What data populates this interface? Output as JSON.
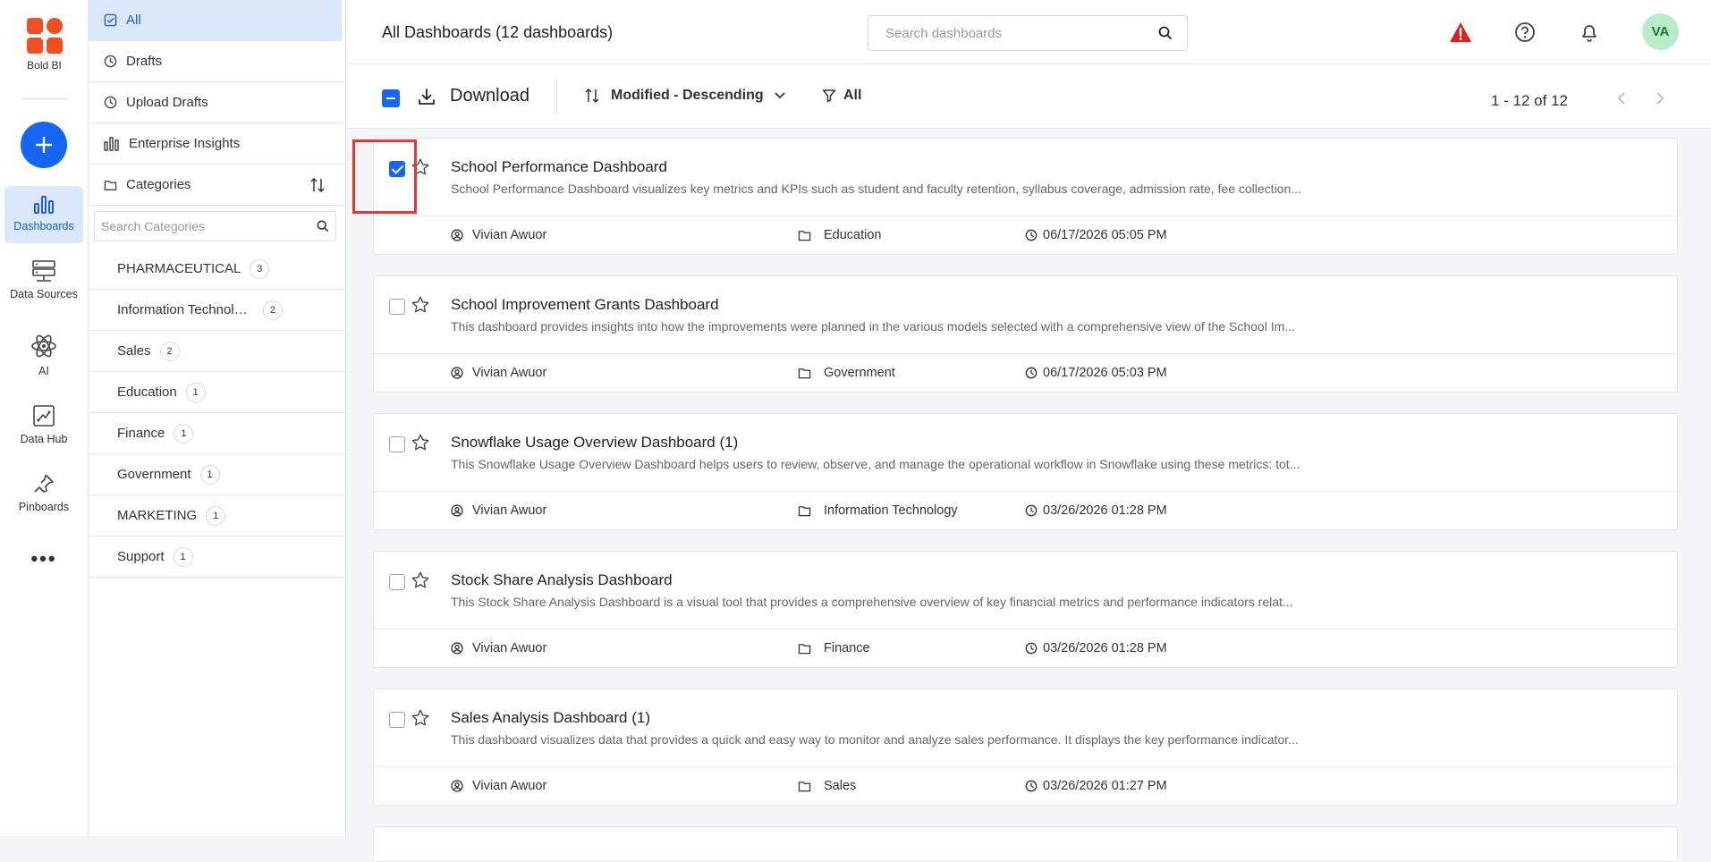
{
  "rail": {
    "logo_text": "Bold BI",
    "items": [
      {
        "label": "Dashboards"
      },
      {
        "label": "Data Sources"
      },
      {
        "label": "AI"
      },
      {
        "label": "Data Hub"
      },
      {
        "label": "Pinboards"
      }
    ]
  },
  "nav": {
    "all": "All",
    "drafts": "Drafts",
    "upload_drafts": "Upload Drafts",
    "enterprise": "Enterprise Insights",
    "categories": "Categories",
    "search_placeholder": "Search Categories"
  },
  "categories": [
    {
      "name": "PHARMACEUTICAL",
      "count": "3"
    },
    {
      "name": "Information Technology",
      "count": "2"
    },
    {
      "name": "Sales",
      "count": "2"
    },
    {
      "name": "Education",
      "count": "1"
    },
    {
      "name": "Finance",
      "count": "1"
    },
    {
      "name": "Government",
      "count": "1"
    },
    {
      "name": "MARKETING",
      "count": "1"
    },
    {
      "name": "Support",
      "count": "1"
    }
  ],
  "header": {
    "title": "All Dashboards (12 dashboards)",
    "search_placeholder": "Search dashboards",
    "avatar": "VA"
  },
  "toolbar": {
    "download": "Download",
    "sort": "Modified - Descending",
    "filter": "All",
    "pager": "1 - 12 of 12"
  },
  "dashboards": [
    {
      "title": "School Performance Dashboard",
      "description": "School Performance Dashboard visualizes key metrics and KPIs such as student and faculty retention, syllabus coverage, admission rate, fee collection...",
      "owner": "Vivian Awuor",
      "category": "Education",
      "modified": "06/17/2026 05:05 PM",
      "checked": true
    },
    {
      "title": "School Improvement Grants Dashboard",
      "description": "This dashboard provides insights into how the improvements were planned in the various models selected with a comprehensive view of the School Im...",
      "owner": "Vivian Awuor",
      "category": "Government",
      "modified": "06/17/2026 05:03 PM",
      "checked": false
    },
    {
      "title": "Snowflake Usage Overview Dashboard (1)",
      "description": "This Snowflake Usage Overview Dashboard helps users to review, observe, and manage the operational workflow in Snowflake using these metrics: tot...",
      "owner": "Vivian Awuor",
      "category": "Information Technology",
      "modified": "03/26/2026 01:28 PM",
      "checked": false
    },
    {
      "title": "Stock Share Analysis Dashboard",
      "description": "This Stock Share Analysis Dashboard is a visual tool that provides a comprehensive overview of key financial metrics and performance indicators relat...",
      "owner": "Vivian Awuor",
      "category": "Finance",
      "modified": "03/26/2026 01:28 PM",
      "checked": false
    },
    {
      "title": "Sales Analysis Dashboard (1)",
      "description": "This dashboard visualizes data that provides a quick and easy way to monitor and analyze sales performance. It displays the key performance indicator...",
      "owner": "Vivian Awuor",
      "category": "Sales",
      "modified": "03/26/2026 01:27 PM",
      "checked": false
    }
  ],
  "colors": {
    "accent": "#1666f6",
    "highlight": "#e53935",
    "warning": "#e02020"
  }
}
